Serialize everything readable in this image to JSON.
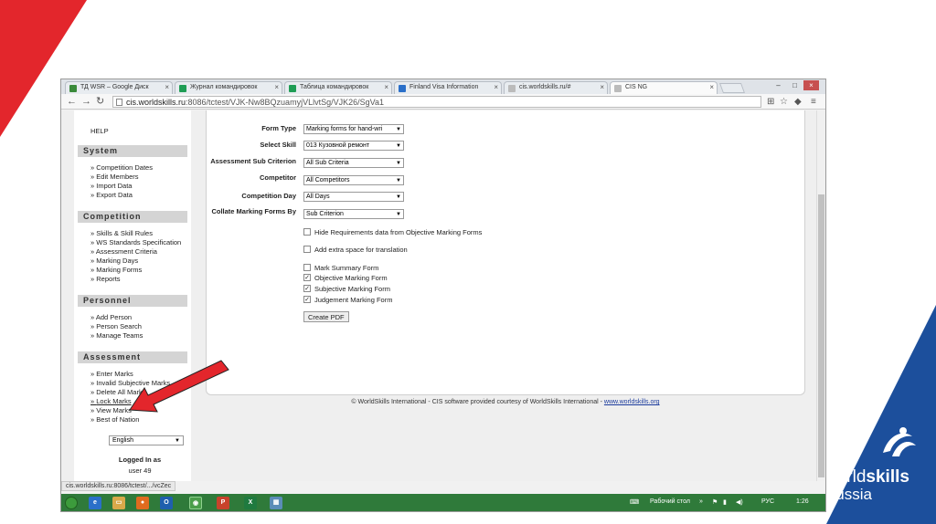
{
  "browser": {
    "tabs": [
      {
        "label": "ТД WSR – Google Диск",
        "color": "#3a8a3a"
      },
      {
        "label": "Журнал командировок",
        "color": "#1f9d55"
      },
      {
        "label": "Таблица командировок",
        "color": "#1f9d55"
      },
      {
        "label": "Finland Visa Information",
        "color": "#2a6fc9"
      },
      {
        "label": "cis.worldskills.ru/#",
        "color": "#888888"
      },
      {
        "label": "CIS NG",
        "color": "#888888"
      }
    ],
    "url_host": "cis.worldskills.ru",
    "url_path": ":8086/tctest/VJK-Nw8BQzuamyjVLlvtSg/VJK26/SgVa1",
    "status_url": "cis.worldskills.ru:8086/tctest/.../vcZec"
  },
  "sidebar": {
    "help": "HELP",
    "sections": [
      {
        "title": "System",
        "items": [
          "Competition Dates",
          "Edit Members",
          "Import Data",
          "Export Data"
        ]
      },
      {
        "title": "Competition",
        "items": [
          "Skills & Skill Rules",
          "WS Standards Specification",
          "Assessment Criteria",
          "Marking Days",
          "Marking Forms",
          "Reports"
        ]
      },
      {
        "title": "Personnel",
        "items": [
          "Add Person",
          "Person Search",
          "Manage Teams"
        ]
      },
      {
        "title": "Assessment",
        "items": [
          "Enter Marks",
          "Invalid Subjective Marks",
          "Delete All Marks",
          "Lock Marks",
          "View Marks",
          "Best of Nation"
        ]
      }
    ],
    "language": "English",
    "logged_in_label": "Logged In as",
    "user": "user 49"
  },
  "form": {
    "fields": [
      {
        "label": "Form Type",
        "value": "Marking forms for hand-wri"
      },
      {
        "label": "Select Skill",
        "value": "013 Кузовной ремонт"
      },
      {
        "label": "Assessment Sub Criterion",
        "value": "All Sub Criteria"
      },
      {
        "label": "Competitor",
        "value": "All Competitors"
      },
      {
        "label": "Competition Day",
        "value": "All Days"
      },
      {
        "label": "Collate Marking Forms By",
        "value": "Sub Criterion"
      }
    ],
    "checkboxes": [
      {
        "label": "Hide Requirements data from Objective Marking Forms",
        "checked": false
      },
      {
        "label": "Add extra space for translation",
        "checked": false
      },
      {
        "label": "Mark Summary Form",
        "checked": false
      },
      {
        "label": "Objective Marking Form",
        "checked": true
      },
      {
        "label": "Subjective Marking Form",
        "checked": true
      },
      {
        "label": "Judgement Marking Form",
        "checked": true
      }
    ],
    "create_pdf": "Create PDF"
  },
  "footer": {
    "text": "© WorldSkills International - CIS software provided courtesy of WorldSkills International -",
    "link": "www.worldskills.org"
  },
  "taskbar": {
    "desktop": "Рабочий стол",
    "lang": "РУС",
    "time": "1:26"
  },
  "logo": {
    "line1a": "world",
    "line1b": "skills",
    "line2": "Russia"
  },
  "colors": {
    "accent_red": "#e3262c",
    "brand_blue": "#1c4f9c",
    "taskbar": "#2f7a3a"
  }
}
